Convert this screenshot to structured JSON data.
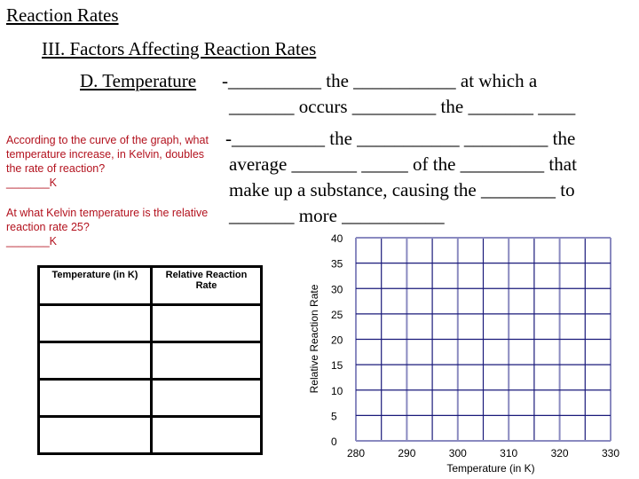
{
  "headings": {
    "title": "Reaction Rates",
    "section": "III.  Factors Affecting Reaction Rates",
    "subsection": "D.  Temperature"
  },
  "body_lines": [
    "-__________ the ___________ at which a",
    "_______ occurs _________ the _______ ____",
    "-__________ the ___________ _________ the",
    "average _______ _____ of the _________ that",
    "make up a substance, causing the ________ to",
    "_______ more ___________"
  ],
  "questions": [
    {
      "text": "According to the curve of the graph, what temperature increase, in Kelvin, doubles the rate of reaction?",
      "answer": "_______K"
    },
    {
      "text": "At what Kelvin temperature is the relative reaction rate 25?",
      "answer": "_______K"
    }
  ],
  "data_table": {
    "headers": [
      "Temperature (in K)",
      "Relative Reaction Rate"
    ],
    "rows": [
      [
        "",
        ""
      ],
      [
        "",
        ""
      ],
      [
        "",
        ""
      ],
      [
        "",
        ""
      ]
    ]
  },
  "colors": {
    "question_text": "#b3121e",
    "grid_line": "#1a1a7a",
    "grid_line_light": "#8a8ac0"
  },
  "chart_data": {
    "type": "line",
    "title": "",
    "xlabel": "Temperature (in K)",
    "ylabel": "Relative Reaction Rate",
    "x_ticks": [
      280,
      290,
      300,
      310,
      320,
      330
    ],
    "y_ticks": [
      0,
      5,
      10,
      15,
      20,
      25,
      30,
      35,
      40
    ],
    "xlim": [
      280,
      330
    ],
    "ylim": [
      0,
      40
    ],
    "grid": true,
    "x_grid_divisions": 10,
    "y_grid_divisions": 8,
    "series": []
  }
}
